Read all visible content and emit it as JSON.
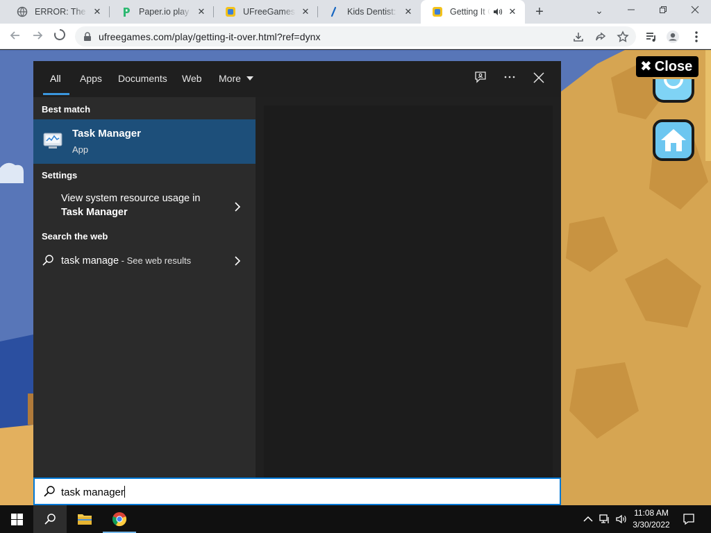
{
  "browser": {
    "tabs": [
      {
        "title": "ERROR: The request could not be satisfied",
        "icon": "globe-icon",
        "active": false
      },
      {
        "title": "Paper.io play online",
        "icon": "paperio-icon",
        "active": false
      },
      {
        "title": "UFreeGames - Free Games",
        "icon": "ufreegames-icon",
        "active": false
      },
      {
        "title": "Kids Dentist: Dentist Games",
        "icon": "kids-dentist-icon",
        "active": false
      },
      {
        "title": "Getting It Over",
        "icon": "ufreegames-icon",
        "active": true,
        "audio": true
      }
    ],
    "new_tab_label": "+",
    "url": "ufreegames.com/play/getting-it-over.html?ref=dynx"
  },
  "game": {
    "close_label": "Close",
    "close_glyph": "✖"
  },
  "search": {
    "tabs": [
      "All",
      "Apps",
      "Documents",
      "Web",
      "More"
    ],
    "active_tab": "All",
    "best_match_heading": "Best match",
    "best_match": {
      "name": "Task Manager",
      "type": "App"
    },
    "settings_heading": "Settings",
    "settings_item": {
      "line1": "View system resource usage in",
      "line2": "Task Manager"
    },
    "web_heading": "Search the web",
    "web_item": {
      "query": "task manage",
      "suffix": " - See web results"
    },
    "query": "task manager"
  },
  "taskbar": {
    "time": "11:08 AM",
    "date": "3/30/2022"
  },
  "colors": {
    "accent": "#0078d7",
    "selected": "#1d4f7a",
    "panel": "#2b2b2b"
  }
}
